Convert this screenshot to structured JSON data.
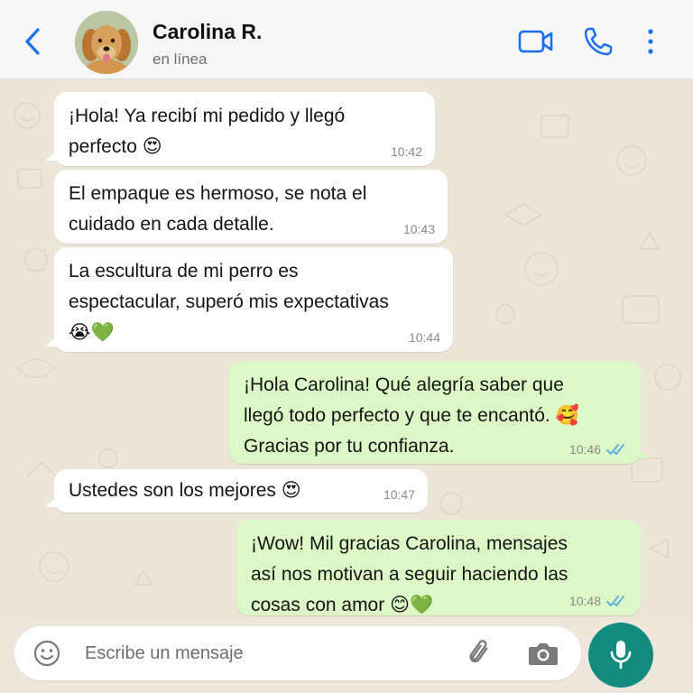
{
  "header": {
    "contact_name": "Carolina R.",
    "status": "en línea",
    "icons": [
      "back-arrow-icon",
      "avatar",
      "video-call-icon",
      "phone-call-icon",
      "more-vertical-icon"
    ]
  },
  "messages": [
    {
      "direction": "in",
      "text": "¡Hola! Ya recibí mi pedido y llegó\nperfecto 😍",
      "time": "10:42"
    },
    {
      "direction": "in",
      "text": "El empaque es hermoso, se nota el\ncuidado en cada detalle.",
      "time": "10:43"
    },
    {
      "direction": "in",
      "text": "La escultura de mi perro es\nespectacular, superó mis expectativas\n😭💚",
      "time": "10:44"
    },
    {
      "direction": "out",
      "text": "¡Hola Carolina! Qué alegría saber que\nllegó todo perfecto y que te encantó. 🥰\nGracias por tu confianza.",
      "time": "10:46",
      "read": true
    },
    {
      "direction": "in",
      "text": "Ustedes son los mejores 😍",
      "time": "10:47"
    },
    {
      "direction": "out",
      "text": "¡Wow! Mil gracias Carolina, mensajes\nasí nos motivan a seguir haciendo las\ncosas con amor 😊💚",
      "time": "10:48",
      "read": true
    }
  ],
  "composer": {
    "placeholder": "Escribe un mensaje",
    "icons": [
      "emoji-icon",
      "attach-icon",
      "camera-icon",
      "mic-icon"
    ]
  },
  "colors": {
    "accent": "#128c7e",
    "icon_blue": "#1a6ff0",
    "outgoing_bubble": "#dcf8c6",
    "incoming_bubble": "#ffffff",
    "read_ticks": "#4fa9e6",
    "chat_background": "#ece5d8"
  }
}
